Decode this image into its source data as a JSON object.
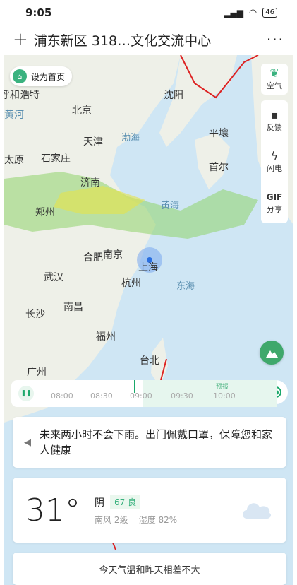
{
  "status": {
    "time": "9:05",
    "signal": "𝄃𝄃𝄃",
    "wifi": "◔",
    "battery": "46"
  },
  "header": {
    "title": "浦东新区 318…文化交流中心",
    "plus": "+",
    "more": "···"
  },
  "map": {
    "home_button": "设为首页",
    "cities": [
      {
        "name": "呼和浩特",
        "red": false
      },
      {
        "name": "沈阳",
        "red": false
      },
      {
        "name": "黄河",
        "red": false
      },
      {
        "name": "北京",
        "red": false
      },
      {
        "name": "天津",
        "red": false
      },
      {
        "name": "平壤",
        "red": false
      },
      {
        "name": "太原",
        "red": false
      },
      {
        "name": "石家庄",
        "red": false
      },
      {
        "name": "首尔",
        "red": false
      },
      {
        "name": "济南",
        "red": false
      },
      {
        "name": "郑州",
        "red": false
      },
      {
        "name": "合肥",
        "red": false
      },
      {
        "name": "南京",
        "red": false
      },
      {
        "name": "上海",
        "red": false
      },
      {
        "name": "武汉",
        "red": false
      },
      {
        "name": "杭州",
        "red": false
      },
      {
        "name": "长沙",
        "red": false
      },
      {
        "name": "南昌",
        "red": false
      },
      {
        "name": "福州",
        "red": false
      },
      {
        "name": "台北",
        "red": false
      },
      {
        "name": "广州",
        "red": false
      }
    ],
    "seas": [
      "渤海",
      "黄海",
      "东海"
    ],
    "side": [
      {
        "icon": "leaf-icon",
        "label": "空气"
      },
      {
        "icon": "feedback-icon",
        "label": "反馈"
      },
      {
        "icon": "lightning-icon",
        "label": "闪电"
      },
      {
        "icon": "gif-icon",
        "glyph": "GIF",
        "label": "分享"
      }
    ],
    "timeline": {
      "ticks": [
        "08:00",
        "08:30",
        "09:00",
        "09:30",
        "10:00"
      ],
      "forecast_label": "预报",
      "play": "❚❚"
    }
  },
  "alert": {
    "text": "未来两小时不会下雨。出门佩戴口罩，保障您和家人健康"
  },
  "weather": {
    "temp": "31°",
    "condition": "阴",
    "aqi": "67 良",
    "wind": "南风 2级",
    "humidity": "湿度 82%"
  },
  "compare": {
    "text": "今天气温和昨天相差不大"
  }
}
